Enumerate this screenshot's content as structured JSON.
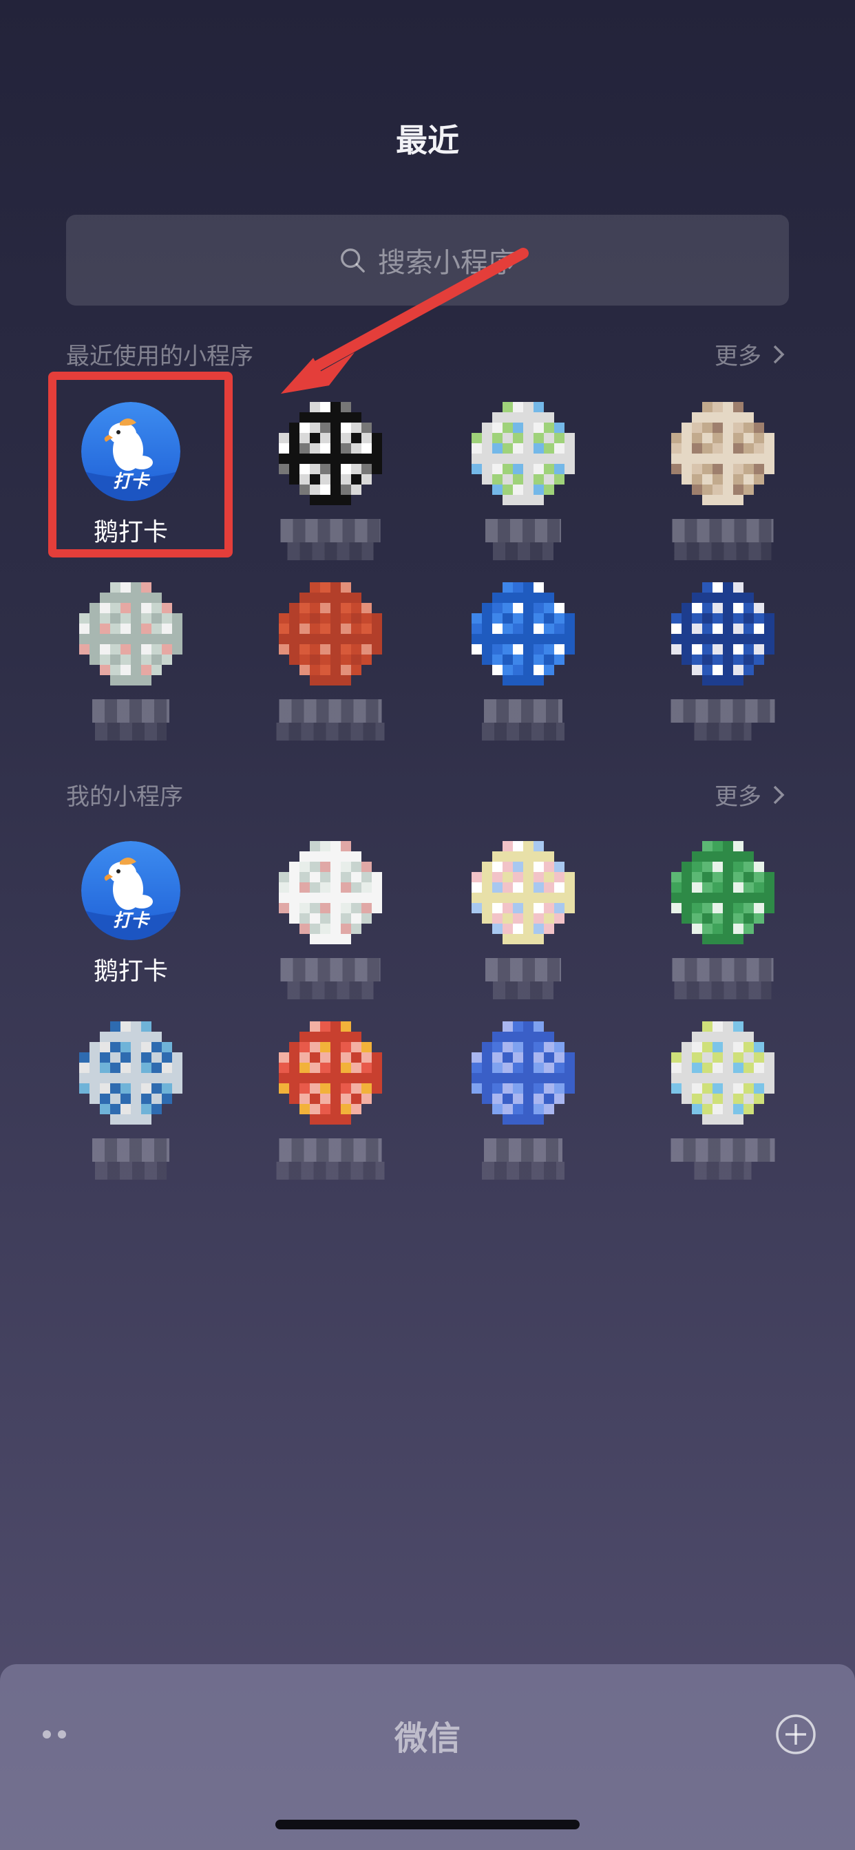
{
  "header": {
    "title": "最近"
  },
  "search": {
    "placeholder": "搜索小程序",
    "icon": "search-icon"
  },
  "recent": {
    "heading": "最近使用的小程序",
    "more_label": "更多",
    "apps": [
      {
        "label": "鹅打卡",
        "icon_text": "打卡",
        "visible": true
      },
      {
        "label": "",
        "visible": false,
        "palette": [
          "#ffffff",
          "#d9d9d9",
          "#777777",
          "#111111"
        ]
      },
      {
        "label": "",
        "visible": false,
        "palette": [
          "#f2f2f2",
          "#9fd27a",
          "#74b8e8",
          "#dcdcdc"
        ]
      },
      {
        "label": "",
        "visible": false,
        "palette": [
          "#d8c4ad",
          "#c2aa8d",
          "#9e7f6d",
          "#e5d8c5"
        ]
      },
      {
        "label": "",
        "visible": false,
        "palette": [
          "#f2f2f2",
          "#c9d6cf",
          "#e6a8a3",
          "#a8b7b1"
        ]
      },
      {
        "label": "",
        "visible": false,
        "palette": [
          "#d85a3a",
          "#c6492e",
          "#e3907a",
          "#b33f2a"
        ]
      },
      {
        "label": "",
        "visible": false,
        "palette": [
          "#2f6fd8",
          "#3e86ea",
          "#ffffff",
          "#1f5bbf"
        ]
      },
      {
        "label": "",
        "visible": false,
        "palette": [
          "#ffffff",
          "#2a58b8",
          "#e6e6ef",
          "#1d3d8e"
        ]
      }
    ]
  },
  "mine": {
    "heading": "我的小程序",
    "more_label": "更多",
    "apps": [
      {
        "label": "鹅打卡",
        "icon_text": "打卡",
        "visible": true
      },
      {
        "label": "",
        "visible": false,
        "palette": [
          "#e8eeea",
          "#c8d4cf",
          "#e0a8a6",
          "#f5f5f5"
        ]
      },
      {
        "label": "",
        "visible": false,
        "palette": [
          "#ffffff",
          "#f2c3c8",
          "#a8c8f0",
          "#e8e0a8"
        ]
      },
      {
        "label": "",
        "visible": false,
        "palette": [
          "#3fa35a",
          "#5cb874",
          "#e8f3ea",
          "#2e8a47"
        ]
      },
      {
        "label": "",
        "visible": false,
        "palette": [
          "#e6e6e6",
          "#2e6bb0",
          "#6fb3d8",
          "#c9d3dc"
        ]
      },
      {
        "label": "",
        "visible": false,
        "palette": [
          "#e85a4a",
          "#f3b0a3",
          "#f2b23a",
          "#c8402f"
        ]
      },
      {
        "label": "",
        "visible": false,
        "palette": [
          "#4a74dc",
          "#a9b6f0",
          "#7fa2f0",
          "#3a5fc7"
        ]
      },
      {
        "label": "",
        "visible": false,
        "palette": [
          "#f0f0f0",
          "#cfe07a",
          "#7cc4e8",
          "#dcdcdc"
        ]
      }
    ]
  },
  "dock": {
    "title": "微信",
    "left_icon": "dots-icon",
    "right_icon": "plus-circle-icon"
  },
  "annotation": {
    "highlight_color": "#e43e3a",
    "arrow_color": "#e43e3a"
  }
}
